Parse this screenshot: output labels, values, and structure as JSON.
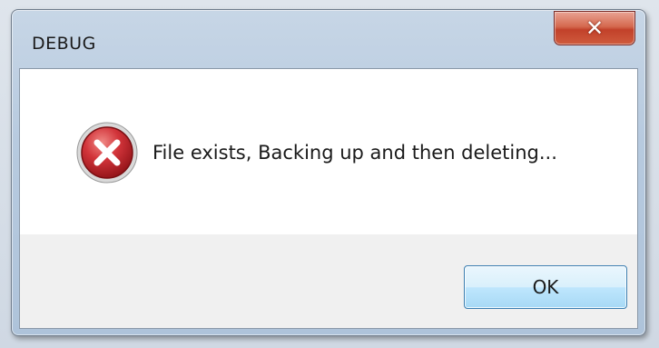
{
  "dialog": {
    "title": "DEBUG",
    "close_glyph": "✕",
    "close_icon": "close-icon",
    "message_icon": "error-icon",
    "message": "File exists, Backing up and then deleting...",
    "ok_label": "OK"
  },
  "colors": {
    "error_red": "#c8252b",
    "close_red": "#c2412a",
    "button_blue": "#a7d9f5"
  }
}
